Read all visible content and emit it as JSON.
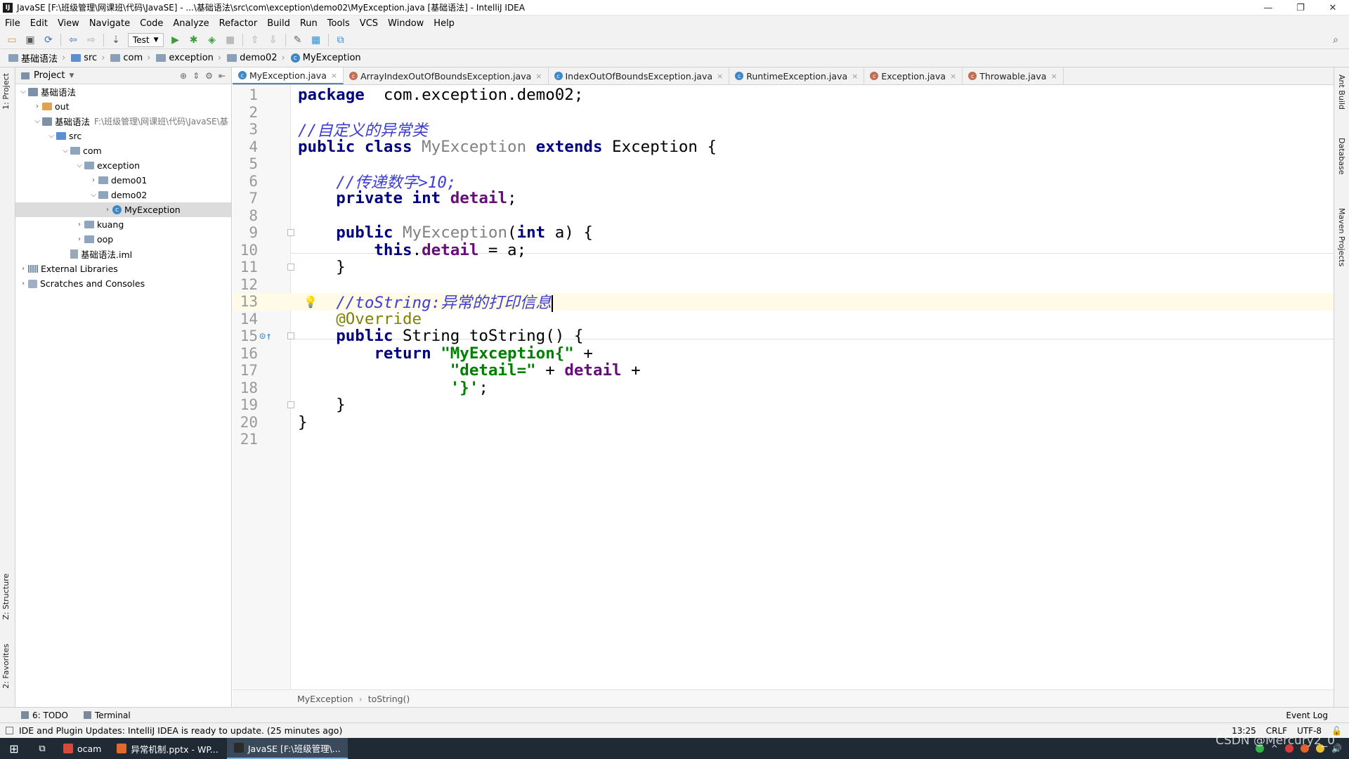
{
  "window": {
    "title": "JavaSE [F:\\班级管理\\网课班\\代码\\JavaSE] - ...\\基础语法\\src\\com\\exception\\demo02\\MyException.java [基础语法] - IntelliJ IDEA",
    "minimize": "—",
    "restore": "❐",
    "close": "✕"
  },
  "menu": [
    "File",
    "Edit",
    "View",
    "Navigate",
    "Code",
    "Analyze",
    "Refactor",
    "Build",
    "Run",
    "Tools",
    "VCS",
    "Window",
    "Help"
  ],
  "toolbar": {
    "run_config": "Test"
  },
  "breadcrumb": [
    "基础语法",
    "src",
    "com",
    "exception",
    "demo02",
    "MyException"
  ],
  "left_strip": {
    "project": "1: Project",
    "structure": "Z: Structure",
    "favorites": "2: Favorites"
  },
  "right_strip": {
    "ant": "Ant Build",
    "database": "Database",
    "maven": "Maven Projects"
  },
  "project_panel": {
    "title": "Project",
    "tree": [
      {
        "label": "基础语法",
        "indent": 0,
        "arrow": "v",
        "icon": "module"
      },
      {
        "label": "out",
        "indent": 1,
        "arrow": ">",
        "icon": "folder-orange"
      },
      {
        "label": "基础语法",
        "path": "F:\\班级管理\\网课班\\代码\\JavaSE\\基",
        "indent": 1,
        "arrow": "v",
        "icon": "module"
      },
      {
        "label": "src",
        "indent": 2,
        "arrow": "v",
        "icon": "folder-src"
      },
      {
        "label": "com",
        "indent": 3,
        "arrow": "v",
        "icon": "folder"
      },
      {
        "label": "exception",
        "indent": 4,
        "arrow": "v",
        "icon": "folder"
      },
      {
        "label": "demo01",
        "indent": 5,
        "arrow": ">",
        "icon": "folder"
      },
      {
        "label": "demo02",
        "indent": 5,
        "arrow": "v",
        "icon": "folder"
      },
      {
        "label": "MyException",
        "indent": 6,
        "arrow": ">",
        "icon": "class",
        "selected": true
      },
      {
        "label": "kuang",
        "indent": 4,
        "arrow": ">",
        "icon": "folder"
      },
      {
        "label": "oop",
        "indent": 4,
        "arrow": ">",
        "icon": "folder"
      },
      {
        "label": "基础语法.iml",
        "indent": 3,
        "arrow": "",
        "icon": "file"
      },
      {
        "label": "External Libraries",
        "indent": 0,
        "arrow": ">",
        "icon": "lib"
      },
      {
        "label": "Scratches and Consoles",
        "indent": 0,
        "arrow": ">",
        "icon": "scratch"
      }
    ]
  },
  "tabs": [
    {
      "label": "MyException.java",
      "active": true,
      "icon": "c"
    },
    {
      "label": "ArrayIndexOutOfBoundsException.java",
      "icon": "exc"
    },
    {
      "label": "IndexOutOfBoundsException.java",
      "icon": "c"
    },
    {
      "label": "RuntimeException.java",
      "icon": "c"
    },
    {
      "label": "Exception.java",
      "icon": "exc"
    },
    {
      "label": "Throwable.java",
      "icon": "exc"
    }
  ],
  "code": [
    {
      "n": "1",
      "tokens": [
        [
          "kw",
          "package"
        ],
        [
          "",
          "  com.exception.demo02;"
        ]
      ]
    },
    {
      "n": "2",
      "tokens": []
    },
    {
      "n": "3",
      "tokens": [
        [
          "cmt",
          "//"
        ],
        [
          "cmt-cn",
          "自定义的异常类"
        ]
      ]
    },
    {
      "n": "4",
      "tokens": [
        [
          "kw",
          "public class "
        ],
        [
          "gray",
          "MyException "
        ],
        [
          "kw",
          "extends "
        ],
        [
          "",
          "Exception {"
        ]
      ]
    },
    {
      "n": "5",
      "tokens": []
    },
    {
      "n": "6",
      "tokens": [
        [
          "",
          "    "
        ],
        [
          "cmt",
          "//"
        ],
        [
          "cmt-cn",
          "传递数字"
        ],
        [
          "cmt",
          ">10;"
        ]
      ]
    },
    {
      "n": "7",
      "tokens": [
        [
          "",
          "    "
        ],
        [
          "kw",
          "private int "
        ],
        [
          "fld",
          "detail"
        ],
        [
          "",
          ";"
        ]
      ]
    },
    {
      "n": "8",
      "tokens": []
    },
    {
      "n": "9",
      "tokens": [
        [
          "",
          "    "
        ],
        [
          "kw",
          "public "
        ],
        [
          "gray",
          "MyException"
        ],
        [
          "",
          "("
        ],
        [
          "kw",
          "int "
        ],
        [
          "",
          "a) {"
        ]
      ]
    },
    {
      "n": "10",
      "tokens": [
        [
          "",
          "        "
        ],
        [
          "kw",
          "this"
        ],
        [
          "",
          "."
        ],
        [
          "fld",
          "detail"
        ],
        [
          "",
          " = a;"
        ]
      ]
    },
    {
      "n": "11",
      "tokens": [
        [
          "",
          "    }"
        ]
      ]
    },
    {
      "n": "12",
      "tokens": []
    },
    {
      "n": "13",
      "tokens": [
        [
          "",
          "    "
        ],
        [
          "cmt",
          "//toString:"
        ],
        [
          "cmt-cn",
          "异常的打印信息"
        ]
      ],
      "current": true
    },
    {
      "n": "14",
      "tokens": [
        [
          "",
          "    "
        ],
        [
          "ann",
          "@Override"
        ]
      ]
    },
    {
      "n": "15",
      "tokens": [
        [
          "",
          "    "
        ],
        [
          "kw",
          "public "
        ],
        [
          "",
          "String toString() {"
        ]
      ]
    },
    {
      "n": "16",
      "tokens": [
        [
          "",
          "        "
        ],
        [
          "kw",
          "return "
        ],
        [
          "str",
          "\"MyException{\""
        ],
        [
          "",
          " +"
        ]
      ]
    },
    {
      "n": "17",
      "tokens": [
        [
          "",
          "                "
        ],
        [
          "str",
          "\"detail=\""
        ],
        [
          "",
          " + "
        ],
        [
          "fld",
          "detail"
        ],
        [
          "",
          " +"
        ]
      ]
    },
    {
      "n": "18",
      "tokens": [
        [
          "",
          "                "
        ],
        [
          "str",
          "'}'"
        ],
        [
          "",
          ";"
        ]
      ]
    },
    {
      "n": "19",
      "tokens": [
        [
          "",
          "    }"
        ]
      ]
    },
    {
      "n": "20",
      "tokens": [
        [
          "",
          "}"
        ]
      ]
    },
    {
      "n": "21",
      "tokens": []
    }
  ],
  "editor_breadcrumb": [
    "MyException",
    "toString()"
  ],
  "bottom_tools": {
    "todo": "6: TODO",
    "terminal": "Terminal",
    "event_log": "Event Log"
  },
  "status": {
    "message": "IDE and Plugin Updates: IntelliJ IDEA is ready to update. (25 minutes ago)",
    "position": "13:25",
    "line_sep": "CRLF",
    "encoding": "UTF-8"
  },
  "taskbar": {
    "items": [
      {
        "label": "ocam",
        "color": "#d64a3b"
      },
      {
        "label": "异常机制.pptx - WP...",
        "color": "#e06a2c"
      },
      {
        "label": "JavaSE [F:\\班级管理\\...",
        "color": "#2b2b2b",
        "active": true
      }
    ],
    "watermark": "CSDN @Mercury2_0"
  }
}
